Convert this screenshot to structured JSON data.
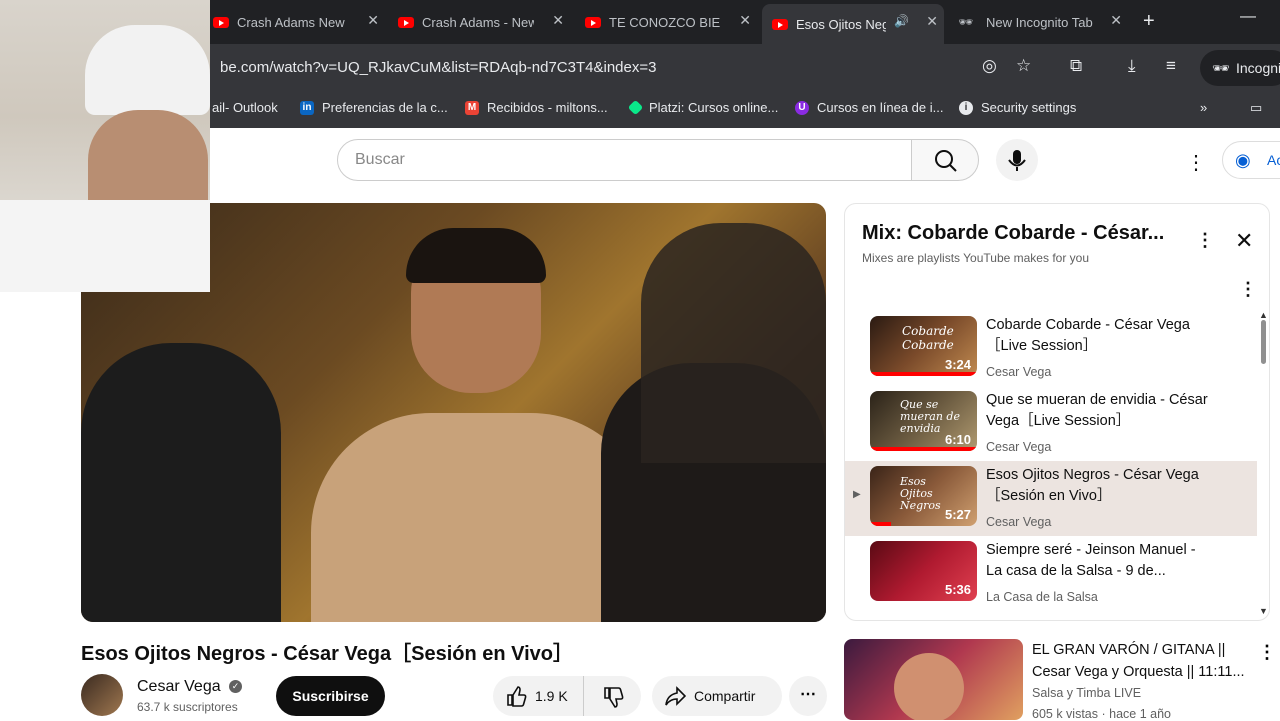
{
  "browser": {
    "tabs": [
      {
        "title": "Crash Adams New"
      },
      {
        "title": "Crash Adams - New"
      },
      {
        "title": "TE CONOZCO BIEN"
      },
      {
        "title": "Esos Ojitos Neg"
      },
      {
        "title": "New Incognito Tab"
      }
    ],
    "url": "be.com/watch?v=UQ_RJkavCuM&list=RDAqb-nd7C3T4&index=3",
    "incognito_label": "Incogni",
    "bookmarks": [
      {
        "label": "ail- Outlook"
      },
      {
        "label": "Preferencias de la c..."
      },
      {
        "label": "Recibidos - miltons..."
      },
      {
        "label": "Platzi: Cursos online..."
      },
      {
        "label": "Cursos en línea de i..."
      },
      {
        "label": "Security settings"
      }
    ]
  },
  "header": {
    "search_placeholder": "Buscar",
    "signin_label": "Ac"
  },
  "video": {
    "title": "Esos Ojitos Negros - César Vega［Sesión en Vivo］",
    "channel": "Cesar Vega",
    "subscribers": "63.7 k suscriptores",
    "subscribe_label": "Suscribirse",
    "likes": "1.9 K",
    "share_label": "Compartir"
  },
  "playlist": {
    "title": "Mix: Cobarde Cobarde - César...",
    "subtitle": "Mixes are playlists YouTube makes for you",
    "items": [
      {
        "title": "Cobarde Cobarde - César Vega［Live Session］",
        "channel": "Cesar Vega",
        "duration": "3:24",
        "thumb_text": "Cobarde Cobarde"
      },
      {
        "title": "Que se mueran de envidia - César Vega［Live Session］",
        "channel": "Cesar Vega",
        "duration": "6:10",
        "thumb_text": "Que se mueran de envidia"
      },
      {
        "title": "Esos Ojitos Negros - César Vega［Sesión en Vivo］",
        "channel": "Cesar Vega",
        "duration": "5:27",
        "thumb_text": "Esos Ojitos Negros"
      },
      {
        "title": "Siempre seré - Jeinson Manuel - La casa de la Salsa - 9 de...",
        "channel": "La Casa de la Salsa",
        "duration": "5:36",
        "thumb_text": ""
      }
    ],
    "active_index": 2
  },
  "recommendation": {
    "title": "EL GRAN VARÓN / GITANA || Cesar Vega y Orquesta || 11:11...",
    "channel": "Salsa y Timba LIVE",
    "meta": "605 k vistas · hace 1 año"
  },
  "colors": {
    "accent": "#ff0000",
    "chrome_dark": "#202124",
    "chrome_mid": "#35363a",
    "active_row": "#ece4e0"
  }
}
